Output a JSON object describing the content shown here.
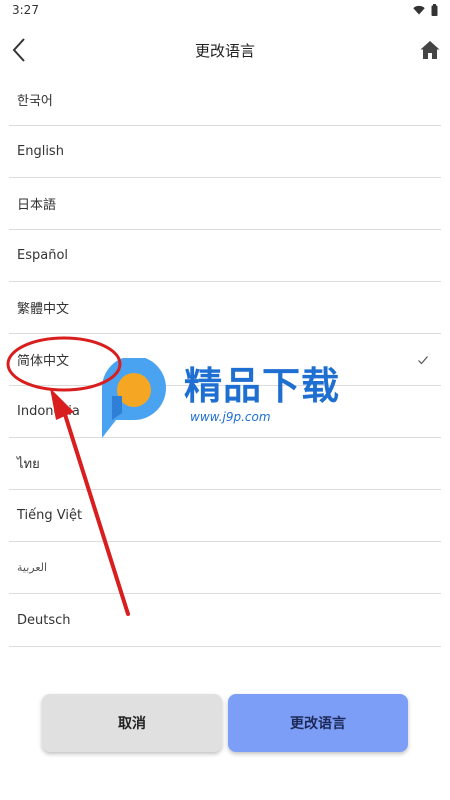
{
  "status_bar": {
    "time": "3:27"
  },
  "header": {
    "title": "更改语言"
  },
  "languages": [
    {
      "label": "한국어",
      "selected": false
    },
    {
      "label": "English",
      "selected": false
    },
    {
      "label": "日本語",
      "selected": false
    },
    {
      "label": "Español",
      "selected": false
    },
    {
      "label": "繁體中文",
      "selected": false
    },
    {
      "label": "简体中文",
      "selected": true
    },
    {
      "label": "Indonesia",
      "selected": false
    },
    {
      "label": "ไทย",
      "selected": false
    },
    {
      "label": "Tiếng Việt",
      "selected": false
    },
    {
      "label": "العربية",
      "selected": false
    },
    {
      "label": "Deutsch",
      "selected": false
    }
  ],
  "buttons": {
    "cancel_label": "取消",
    "confirm_label": "更改语言"
  },
  "watermark": {
    "name": "精品下载",
    "url": "www.j9p.com"
  },
  "colors": {
    "confirm_button": "#7d9ef7",
    "cancel_button": "#e0e0e0",
    "annotation": "#d81e1e",
    "logo_blue": "#4aa3f0",
    "logo_orange": "#f5a623"
  }
}
